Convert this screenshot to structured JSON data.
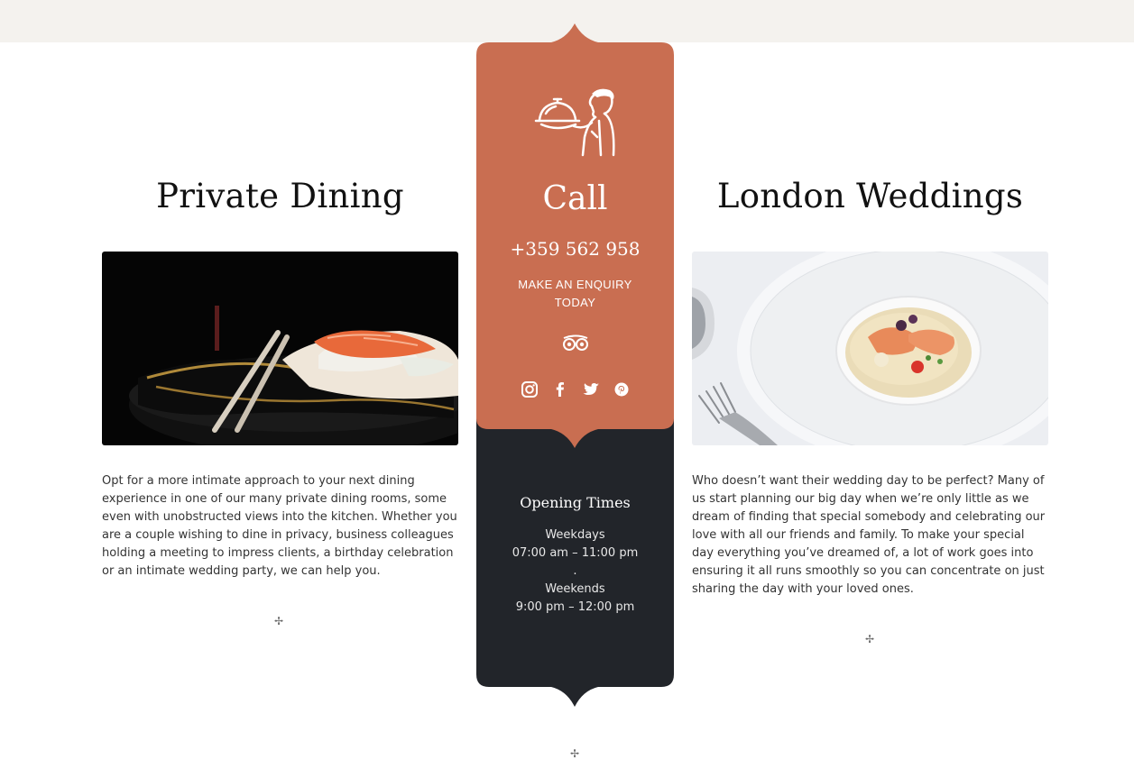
{
  "left": {
    "title": "Private Dining",
    "body": "Opt for a more intimate approach to your next dining experience in one of our many private dining rooms, some even with unobstructed views into the kitchen. Whether you are a couple wishing to dine in privacy, business colleagues holding a meeting to impress clients, a birthday celebration or an intimate wedding party, we can help you.",
    "image": "sushi-with-chopsticks-photo"
  },
  "right": {
    "title": "London Weddings",
    "body": "Who doesn’t want their wedding day to be perfect? Many of us start planning our big day when we’re only little as we dream of finding that special somebody and celebrating our love with all our friends and family. To make your special day everything you’ve dreamed of, a lot of work goes into ensuring it all runs smoothly so you can concentrate on just sharing the day with your loved ones.",
    "image": "seafood-plate-with-fork-photo"
  },
  "center": {
    "call_title": "Call",
    "phone": "+359 562 958",
    "enquiry_label": "MAKE AN ENQUIRY TODAY",
    "icons": [
      "waiter-cloche-icon",
      "tripadvisor-icon",
      "instagram-icon",
      "facebook-icon",
      "twitter-icon",
      "pinterest-icon"
    ],
    "hours": {
      "title": "Opening Times",
      "weekdays_label": "Weekdays",
      "weekdays_time": "07:00 am – 11:00 pm",
      "separator": ".",
      "weekends_label": "Weekends",
      "weekends_time": "9:00 pm – 12:00 pm"
    }
  },
  "divider_glyph": "✢",
  "colors": {
    "accent": "#c96e51",
    "dark": "#22252a",
    "top_band": "#f4f2ee",
    "text": "#333333"
  }
}
